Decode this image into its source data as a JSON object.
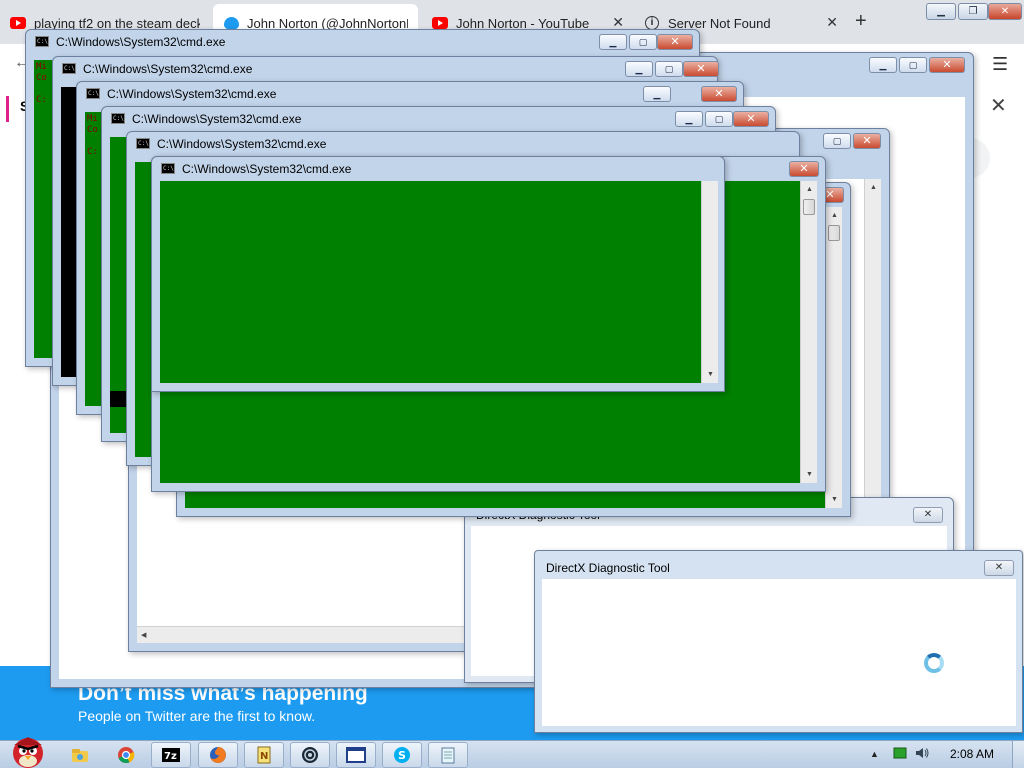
{
  "browser": {
    "tabs": [
      {
        "title": "playing tf2 on the steam deck",
        "icon": "youtube-icon"
      },
      {
        "title": "John Norton (@JohnNortonF",
        "icon": "twitter-icon"
      },
      {
        "title": "John Norton - YouTube",
        "icon": "youtube-icon"
      },
      {
        "title": "Server Not Found",
        "icon": "info-icon"
      }
    ],
    "new_tab": "+",
    "page_letter": "S",
    "banner_title": "Don’t miss what’s happening",
    "banner_subtitle": "People on Twitter are the first to know."
  },
  "cmd": {
    "title": "C:\\Windows\\System32\\cmd.exe",
    "background_color": "#008000",
    "snippet_lines": [
      "Mi",
      "Co",
      "",
      "C:"
    ]
  },
  "directx": {
    "title": "DirectX Diagnostic Tool",
    "back_title": "DirectX Diagnostic Tool"
  },
  "taskbar": {
    "clock": "2:08 AM",
    "items": [
      "explorer-icon",
      "chrome-icon",
      "7zip-icon",
      "firefox-icon",
      "notepad-plus-icon",
      "steam-icon",
      "window-icon",
      "skype-icon",
      "notepad-icon"
    ]
  }
}
